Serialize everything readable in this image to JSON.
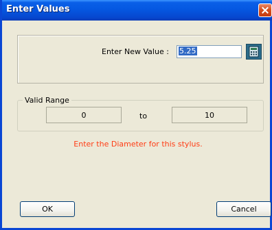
{
  "window": {
    "title": "Enter Values"
  },
  "input": {
    "label": "Enter New Value :",
    "value": "5.25"
  },
  "range": {
    "group_label": "Valid Range",
    "min": "0",
    "to_label": "to",
    "max": "10"
  },
  "hint": "Enter the Diameter for this stylus.",
  "buttons": {
    "ok": "OK",
    "cancel": "Cancel"
  },
  "icons": {
    "close": "close-icon",
    "calculator": "calculator-icon"
  },
  "colors": {
    "titlebar": "#0558e1",
    "hint": "#ff3c14",
    "dialog_bg": "#ece9d8"
  }
}
